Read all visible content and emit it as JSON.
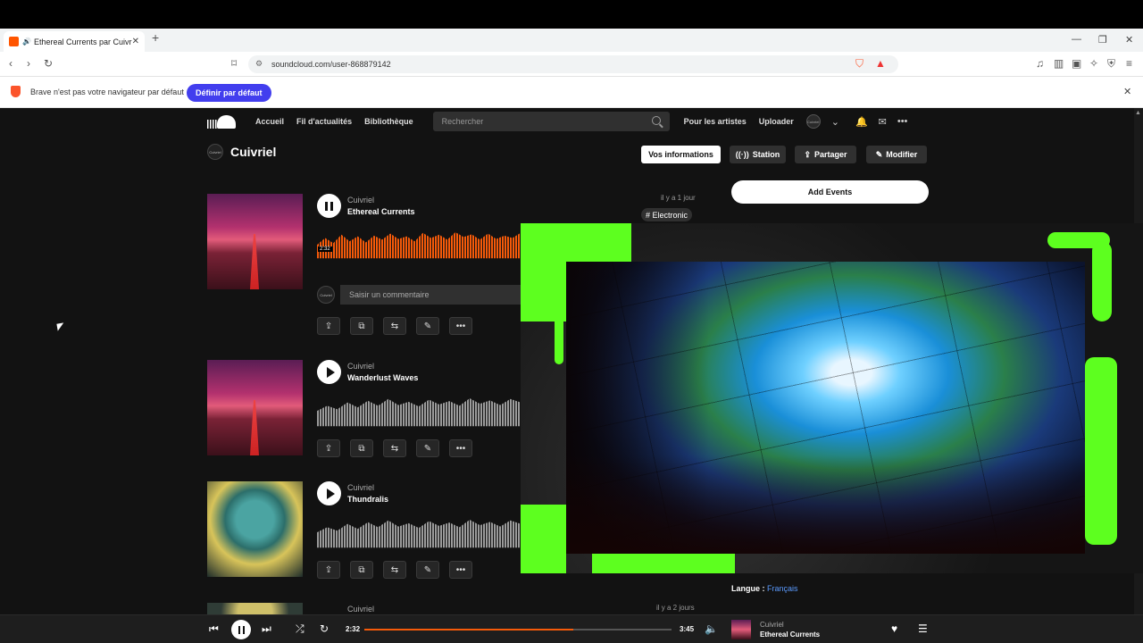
{
  "browser": {
    "tab_title": "Ethereal Currents par Cuivriel",
    "url": "soundcloud.com/user-868879142",
    "infobar_message": "Brave n'est pas votre navigateur par défaut",
    "infobar_button": "Définir par défaut"
  },
  "header": {
    "nav": [
      "Accueil",
      "Fil d'actualités",
      "Bibliothèque"
    ],
    "search_placeholder": "Rechercher",
    "links": [
      "Pour les artistes",
      "Uploader"
    ],
    "avatar_text": "Cuivriel"
  },
  "profile": {
    "name": "Cuivriel",
    "buttons": [
      "Vos informations",
      "Station",
      "Partager",
      "Modifier"
    ]
  },
  "tracks": [
    {
      "artist": "Cuivriel",
      "title": "Ethereal Currents",
      "time_ago": "il y a 1 jour",
      "tag": "# Electronic",
      "position": "2:32",
      "playing": true
    },
    {
      "artist": "Cuivriel",
      "title": "Wanderlust Waves",
      "playing": false
    },
    {
      "artist": "Cuivriel",
      "title": "Thundralis",
      "playing": false
    },
    {
      "artist": "Cuivriel",
      "title": "",
      "time_ago": "il y a 2 jours",
      "playing": false
    }
  ],
  "comment_placeholder": "Saisir un commentaire",
  "sidebar": {
    "add_events": "Add Events",
    "language_label": "Langue :",
    "language_value": "Français"
  },
  "player": {
    "current_time": "2:32",
    "duration": "3:45",
    "progress": 0.68,
    "artist": "Cuivriel",
    "title": "Ethereal Currents"
  },
  "colors": {
    "accent": "#f55a0a",
    "brave_button": "#423eee",
    "overlay_green": "#5dff1f"
  }
}
